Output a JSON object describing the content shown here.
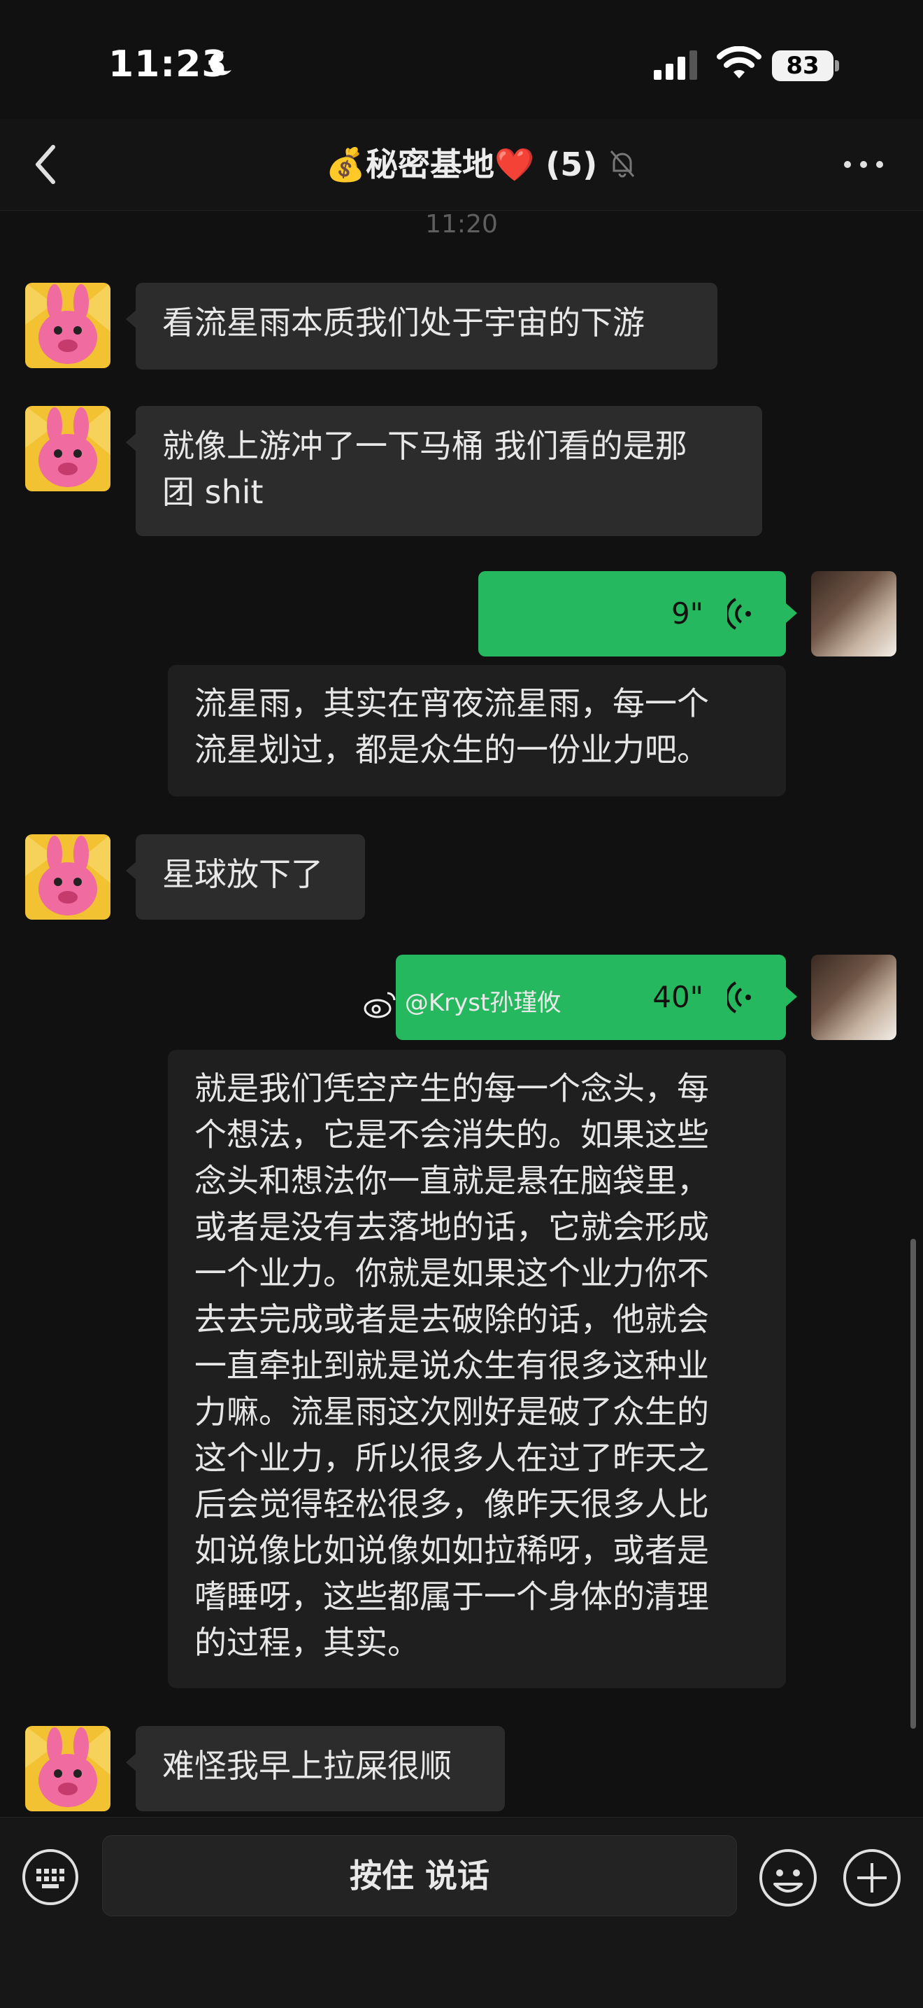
{
  "status_bar": {
    "time": "11:23",
    "battery": "83"
  },
  "header": {
    "title": "💰秘密基地❤️ (5)"
  },
  "timestamp": "11:20",
  "messages": [
    {
      "side": "left",
      "text_lines": [
        "看流星雨本质我们处于宇宙的下游"
      ]
    },
    {
      "side": "left",
      "text_lines": [
        "就像上游冲了一下马桶 我们看的是那",
        "团 shit"
      ]
    },
    {
      "side": "right",
      "voice_duration": "9\"",
      "transcript_lines": [
        "流星雨，其实在宵夜流星雨，每一个",
        "流星划过，都是众生的一份业力吧。"
      ]
    },
    {
      "side": "left",
      "text_lines": [
        "星球放下了"
      ]
    },
    {
      "side": "right",
      "voice_duration": "40\"",
      "transcript_lines": [
        "就是我们凭空产生的每一个念头，每",
        "个想法，它是不会消失的。如果这些",
        "念头和想法你一直就是悬在脑袋里，",
        "或者是没有去落地的话，它就会形成",
        "一个业力。你就是如果这个业力你不",
        "去去完成或者是去破除的话，他就会",
        "一直牵扯到就是说众生有很多这种业",
        "力嘛。流星雨这次刚好是破了众生的",
        "这个业力，所以很多人在过了昨天之",
        "后会觉得轻松很多，像昨天很多人比",
        "如说像比如说像如如拉稀呀，或者是",
        "嗜睡呀，这些都属于一个身体的清理",
        "的过程，其实。"
      ]
    },
    {
      "side": "left",
      "text_lines": [
        "难怪我早上拉屎很顺"
      ]
    }
  ],
  "watermark": "@Kryst孙瑾攸",
  "input_bar": {
    "talk_label": "按住 说话"
  },
  "colors": {
    "background": "#111111",
    "bubble": "#2c2c2c",
    "voice_green": "#26b85f",
    "transcript_bg": "#1f1f1f"
  },
  "icons": [
    "moon-icon",
    "signal-icon",
    "wifi-icon",
    "back-icon",
    "mute-bell-icon",
    "more-icon",
    "voice-wave-icon",
    "weibo-icon",
    "keyboard-icon",
    "emoji-icon",
    "plus-icon"
  ]
}
